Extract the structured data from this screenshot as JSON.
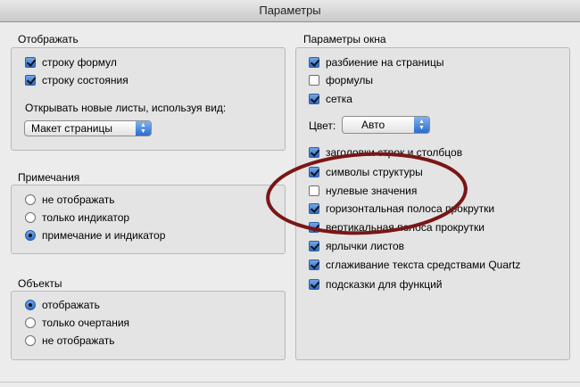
{
  "window": {
    "title": "Параметры"
  },
  "display": {
    "title": "Отображать",
    "formula_bar": "строку формул",
    "status_bar": "строку состояния",
    "open_view_label": "Открывать новые листы, используя вид:",
    "open_view_value": "Макет страницы"
  },
  "comments": {
    "title": "Примечания",
    "options": [
      "не отображать",
      "только индикатор",
      "примечание и индикатор"
    ]
  },
  "objects": {
    "title": "Объекты",
    "options": [
      "отображать",
      "только очертания",
      "не отображать"
    ]
  },
  "window_options": {
    "title": "Параметры окна",
    "page_breaks": "разбиение на страницы",
    "formulas": "формулы",
    "grid": "сетка",
    "color_label": "Цвет:",
    "color_value": "Авто",
    "headers": "заголовки строк и столбцов",
    "outline": "символы структуры",
    "zero_values": "нулевые значения",
    "h_scroll": "горизонтальная полоса прокрутки",
    "v_scroll": "вертикальная полоса прокрутки",
    "sheet_tabs": "ярлычки листов",
    "antialias": "сглаживание текста средствами Quartz",
    "fn_tooltips": "подсказки для функций"
  },
  "state": {
    "formula_bar": true,
    "status_bar": true,
    "comments_selected": 2,
    "objects_selected": 0,
    "page_breaks": true,
    "formulas": false,
    "grid": true,
    "headers": true,
    "outline": true,
    "zero_values": false,
    "h_scroll": true,
    "v_scroll": true,
    "sheet_tabs": true,
    "antialias": true,
    "fn_tooltips": true
  },
  "colors": {
    "annotation_ellipse": "#7a1616"
  }
}
